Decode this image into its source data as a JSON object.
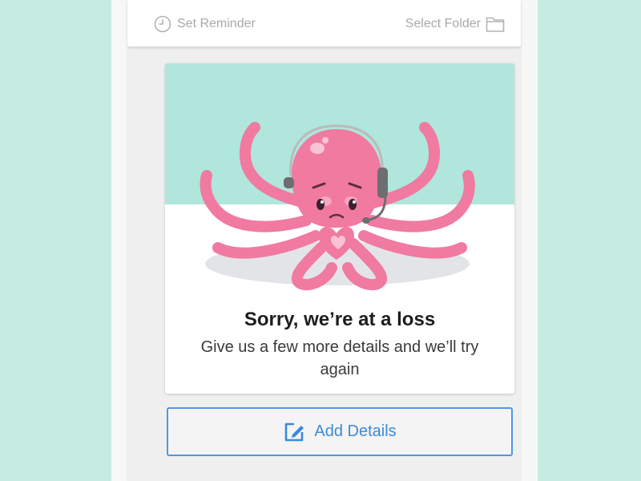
{
  "toolbar": {
    "reminder_label": "Set Reminder",
    "reminder_icon": "clock-icon",
    "folder_label": "Select Folder",
    "folder_icon": "folder-icon"
  },
  "message": {
    "title": "Sorry, we’re at a loss",
    "body": "Give us a few more details and we’ll try again",
    "illustration": "octopus-with-headset"
  },
  "action": {
    "label": "Add Details",
    "icon": "edit-icon"
  },
  "colors": {
    "background": "#c6ece2",
    "illustration_band": "#b0e6db",
    "octopus": "#f07aa0",
    "accent": "#3b8ad9"
  }
}
